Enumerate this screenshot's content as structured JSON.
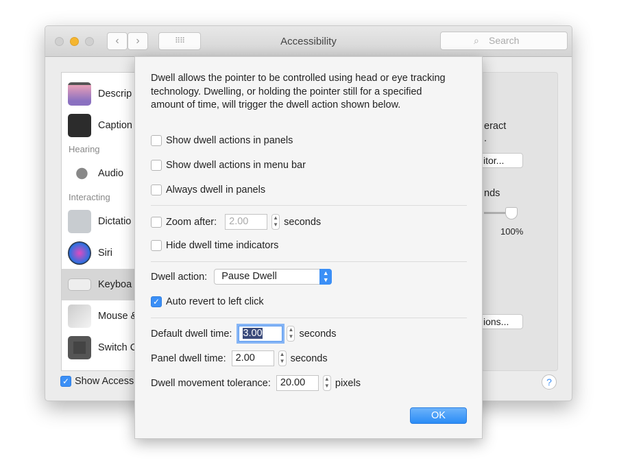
{
  "window": {
    "title": "Accessibility",
    "search_placeholder": "Search",
    "back_icon": "chevron-left",
    "forward_icon": "chevron-right",
    "grid_icon": "show-all-grid"
  },
  "sidebar": {
    "items": [
      {
        "label": "Descrip",
        "icon": "descriptions-icon"
      },
      {
        "label": "Caption",
        "icon": "captions-icon"
      },
      {
        "section": "Hearing"
      },
      {
        "label": "Audio",
        "icon": "speaker-icon"
      },
      {
        "section": "Interacting"
      },
      {
        "label": "Dictatio",
        "icon": "microphone-icon"
      },
      {
        "label": "Siri",
        "icon": "siri-icon"
      },
      {
        "label": "Keyboa",
        "icon": "keyboard-icon",
        "selected": true
      },
      {
        "label": "Mouse &",
        "icon": "mouse-icon"
      },
      {
        "label": "Switch C",
        "icon": "switch-control-icon"
      }
    ]
  },
  "bottom": {
    "show_status_label": "Show Access",
    "show_status_checked": true,
    "help": "?"
  },
  "right_panel": {
    "text1": "eract",
    "text2": ".",
    "button1": "itor...",
    "text3": "nds",
    "slider_value_label": "100%",
    "slider_percent": 100,
    "button2": "ions..."
  },
  "dialog": {
    "description": "Dwell allows the pointer to be controlled using head or eye tracking technology. Dwelling, or holding the pointer still for a specified amount of time, will trigger the dwell action shown below.",
    "show_in_panels": {
      "label": "Show dwell actions in panels",
      "checked": false
    },
    "show_in_menubar": {
      "label": "Show dwell actions in menu bar",
      "checked": false
    },
    "always_dwell": {
      "label": "Always dwell in panels",
      "checked": false
    },
    "zoom_after": {
      "label": "Zoom after:",
      "checked": false,
      "value": "2.00",
      "unit": "seconds"
    },
    "hide_indicators": {
      "label": "Hide dwell time indicators",
      "checked": false
    },
    "dwell_action": {
      "label": "Dwell action:",
      "value": "Pause Dwell"
    },
    "auto_revert": {
      "label": "Auto revert to left click",
      "checked": true
    },
    "default_time": {
      "label": "Default dwell time:",
      "value": "3.00",
      "unit": "seconds"
    },
    "panel_time": {
      "label": "Panel dwell time:",
      "value": "2.00",
      "unit": "seconds"
    },
    "tolerance": {
      "label": "Dwell movement tolerance:",
      "value": "20.00",
      "unit": "pixels"
    },
    "ok": "OK"
  },
  "colors": {
    "accent": "#3b8ff6",
    "minimize": "#f5b630"
  }
}
